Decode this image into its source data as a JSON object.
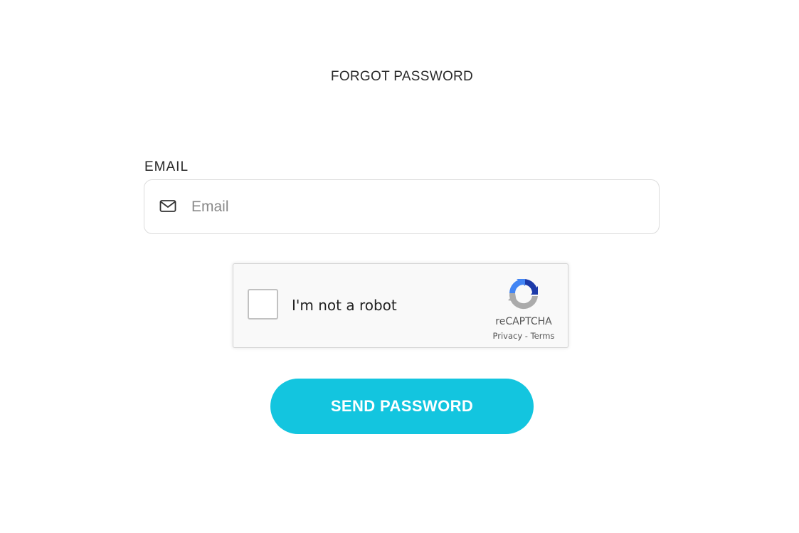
{
  "page": {
    "title": "FORGOT PASSWORD"
  },
  "form": {
    "email_label": "EMAIL",
    "email_placeholder": "Email",
    "email_value": "",
    "email_icon": "envelope-icon"
  },
  "captcha": {
    "checkbox_label": "I'm not a robot",
    "checked": false,
    "brand": "reCAPTCHA",
    "privacy_link": "Privacy",
    "separator": "-",
    "terms_link": "Terms",
    "logo_icon": "recaptcha-logo-icon"
  },
  "actions": {
    "send_label": "SEND PASSWORD"
  },
  "colors": {
    "accent": "#13c5df",
    "text": "#2a2a2a",
    "border": "#dcdcdc",
    "captcha_bg": "#f9f9f9"
  }
}
